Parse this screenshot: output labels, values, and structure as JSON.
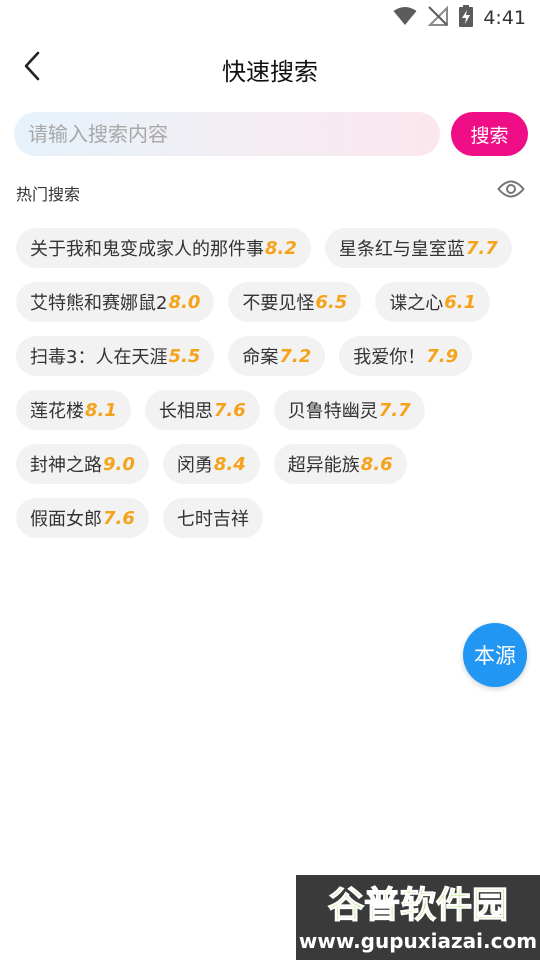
{
  "status_bar": {
    "time": "4:41",
    "icons": [
      "wifi-icon",
      "no-signal-icon",
      "battery-charging-icon"
    ]
  },
  "header": {
    "title": "快速搜索",
    "back_icon": "chevron-left-icon"
  },
  "search": {
    "placeholder": "请输入搜索内容",
    "value": "",
    "button_label": "搜索"
  },
  "hot": {
    "title": "热门搜索",
    "toggle_icon": "eye-icon",
    "items": [
      {
        "name": "关于我和鬼变成家人的那件事",
        "score": "8.2"
      },
      {
        "name": "星条红与皇室蓝",
        "score": "7.7"
      },
      {
        "name": "艾特熊和赛娜鼠2",
        "score": "8.0"
      },
      {
        "name": "不要见怪",
        "score": "6.5"
      },
      {
        "name": "谍之心",
        "score": "6.1"
      },
      {
        "name": "扫毒3：人在天涯",
        "score": "5.5"
      },
      {
        "name": "命案",
        "score": "7.2"
      },
      {
        "name": "我爱你！",
        "score": "7.9"
      },
      {
        "name": "莲花楼",
        "score": "8.1"
      },
      {
        "name": "长相思",
        "score": "7.6"
      },
      {
        "name": "贝鲁特幽灵",
        "score": "7.7"
      },
      {
        "name": "封神之路",
        "score": "9.0"
      },
      {
        "name": "闵勇",
        "score": "8.4"
      },
      {
        "name": "超异能族",
        "score": "8.6"
      },
      {
        "name": "假面女郎",
        "score": "7.6"
      },
      {
        "name": "七时吉祥",
        "score": ""
      }
    ]
  },
  "source_button": {
    "label": "本源"
  },
  "watermark": {
    "logo_text": "谷普软件园",
    "url": "www.gupuxiazai.com"
  },
  "colors": {
    "accent_pink": "#ef0e85",
    "score_orange": "#f5a31a",
    "fab_blue": "#2196f3",
    "tag_bg": "#f2f2f2"
  }
}
